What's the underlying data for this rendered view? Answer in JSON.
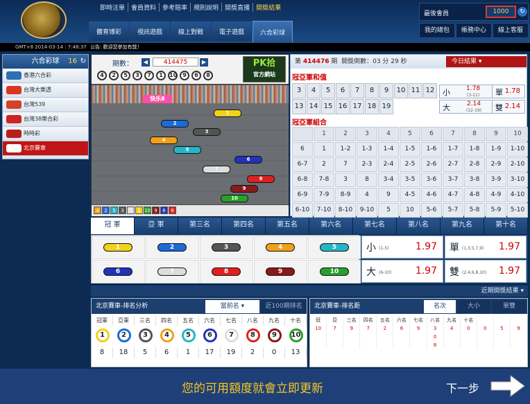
{
  "header": {
    "top_links": [
      "即時注單",
      "會員資料",
      "參考賠率",
      "規則說明",
      "開獎直播",
      "開獎結果"
    ],
    "tabs": [
      "體育博彩",
      "視訊遊戲",
      "線上對戰",
      "電子遊戲",
      "六合彩球"
    ],
    "account_label": "最後會員",
    "balance": "1000",
    "account_links": [
      "我的總包",
      "帳務中心",
      "線上客服"
    ]
  },
  "marquee": {
    "time": "GMT+8 2014-03-14 : 7:48:37",
    "text": "公告:  歡迎您參加有獎！"
  },
  "sidebar": {
    "title": "六合彩球",
    "count": "16",
    "items": [
      {
        "label": "香港六合彩",
        "color": "#2d6fb5"
      },
      {
        "label": "台灣大樂透",
        "color": "#d8361f"
      },
      {
        "label": "台灣539",
        "color": "#d64028"
      },
      {
        "label": "台灣38樂合彩",
        "color": "#cf2323"
      },
      {
        "label": "時時彩",
        "color": "#b81d1d"
      },
      {
        "label": "北京賽車",
        "color": "#e23b3b"
      }
    ]
  },
  "game": {
    "period_label": "期數：",
    "period": "414475",
    "balls": [
      "4",
      "2",
      "5",
      "3",
      "7",
      "1",
      "10",
      "9",
      "6",
      "8"
    ],
    "logo": "PK拾",
    "logo_sub": "官方網站",
    "banner": "快乐8",
    "cars": [
      {
        "n": "1",
        "color": "#f2d21a"
      },
      {
        "n": "2",
        "color": "#1a6bd8"
      },
      {
        "n": "3",
        "color": "#555555"
      },
      {
        "n": "4",
        "color": "#f0a01a"
      },
      {
        "n": "5",
        "color": "#22b7c8"
      },
      {
        "n": "6",
        "color": "#2233b8"
      },
      {
        "n": "7",
        "color": "#dddddd"
      },
      {
        "n": "8",
        "color": "#e02020"
      },
      {
        "n": "9",
        "color": "#8a1a1a"
      },
      {
        "n": "10",
        "color": "#2aa02a"
      }
    ],
    "footer": [
      "4",
      "2",
      "5",
      "3",
      "7",
      "1",
      "10",
      "9",
      "6",
      "8"
    ]
  },
  "right": {
    "issue_prefix": "第",
    "issue": "414476",
    "issue_suffix": "期",
    "countdown": "開獎倒數：03 分 29 秒",
    "today": "今日結果 ▾",
    "sec1": "冠亞軍和值",
    "sums": [
      "3",
      "4",
      "5",
      "6",
      "7",
      "8",
      "9",
      "10",
      "11",
      "12",
      "13",
      "14",
      "15",
      "16",
      "17",
      "18",
      "19"
    ],
    "big": {
      "k": "小",
      "o": "1.78",
      "s": "(3-11)"
    },
    "odd": {
      "k": "單",
      "o": "1.78"
    },
    "small": {
      "k": "大",
      "o": "2.14",
      "s": "(12-19)"
    },
    "even": {
      "k": "雙",
      "o": "2.14"
    },
    "sec2": "冠亞軍組合",
    "combo_header": [
      "",
      "1",
      "2",
      "3",
      "4",
      "5",
      "6",
      "7",
      "8",
      "9",
      "10"
    ],
    "combo_rows": [
      [
        "6",
        "1",
        "1-2",
        "1-3",
        "1-4",
        "1-5",
        "1-6",
        "1-7",
        "1-8",
        "1-9",
        "1-10"
      ],
      [
        "6-7",
        "2",
        "7",
        "2-3",
        "2-4",
        "2-5",
        "2-6",
        "2-7",
        "2-8",
        "2-9",
        "2-10"
      ],
      [
        "6-8",
        "7-8",
        "3",
        "8",
        "3-4",
        "3-5",
        "3-6",
        "3-7",
        "3-8",
        "3-9",
        "3-10"
      ],
      [
        "6-9",
        "7-9",
        "8-9",
        "4",
        "9",
        "4-5",
        "4-6",
        "4-7",
        "4-8",
        "4-9",
        "4-10"
      ],
      [
        "6-10",
        "7-10",
        "8-10",
        "9-10",
        "5",
        "10",
        "5-6",
        "5-7",
        "5-8",
        "5-9",
        "5-10"
      ]
    ]
  },
  "ranks": [
    "冠 軍",
    "亞 軍",
    "第三名",
    "第四名",
    "第五名",
    "第六名",
    "第七名",
    "第八名",
    "第九名",
    "第十名"
  ],
  "odds": [
    {
      "k": "小",
      "s": "(1-5)",
      "v": "1.97"
    },
    {
      "k": "單",
      "s": "(1,3,5,7,9)",
      "v": "1.97"
    },
    {
      "k": "大",
      "s": "(6-10)",
      "v": "1.97"
    },
    {
      "k": "雙",
      "s": "(2,4,6,8,10)",
      "v": "1.97"
    }
  ],
  "recent": "近期開獎結果 ▾",
  "left_panel": {
    "title": "北京賽車-排名分析",
    "tab1": "當前名 ▾",
    "tab2": "近100期排名",
    "cols": [
      "冠軍",
      "亞軍",
      "三名",
      "四名",
      "五名",
      "六名",
      "七名",
      "八名",
      "九名",
      "十名"
    ],
    "balls": [
      "1",
      "2",
      "3",
      "4",
      "5",
      "6",
      "7",
      "8",
      "9",
      "10"
    ],
    "nums": [
      "8",
      "18",
      "5",
      "6",
      "1",
      "17",
      "19",
      "2",
      "0",
      "13"
    ]
  },
  "right_panel": {
    "title": "北京賽車-排名距",
    "tab1": "名次",
    "tab2": "大小",
    "tab3": "單雙",
    "cols": [
      "冠",
      "亞",
      "三名",
      "四名",
      "五名",
      "六名",
      "七名",
      "八名",
      "九名",
      "十名",
      "",
      "",
      ""
    ],
    "row1": [
      "10",
      "7",
      "9",
      "7",
      "2",
      "6",
      "9",
      "3",
      "4",
      "0",
      "0",
      "5",
      "9"
    ],
    "row2": [
      "",
      "",
      "",
      "",
      "",
      "",
      "",
      "0",
      "",
      "",
      "",
      "",
      ""
    ],
    "row3": [
      "",
      "",
      "",
      "",
      "",
      "",
      "",
      "8",
      "",
      "",
      "",
      "",
      ""
    ]
  },
  "overlay": {
    "message": "您的可用額度就會立即更新",
    "next": "下一步"
  }
}
